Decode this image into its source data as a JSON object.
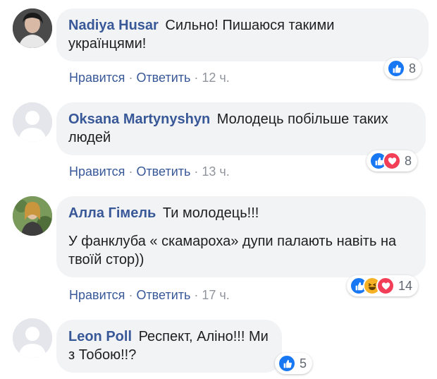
{
  "colors": {
    "link": "#385898",
    "like": "#1877f2",
    "love": "#f33e58",
    "haha": "#f7b125",
    "bubble": "#f2f3f5"
  },
  "comments": [
    {
      "author": "Nadiya Husar",
      "text": "Сильно! Пишаюся такими українцями!",
      "like": "Нравится",
      "reply": "Ответить",
      "time": "12 ч.",
      "reactions": [
        "like-icon"
      ],
      "reaction_count": "8",
      "avatar": "user-photo"
    },
    {
      "author": "Oksana Martynyshyn",
      "text": "Молодець побільше таких людей",
      "like": "Нравится",
      "reply": "Ответить",
      "time": "13 ч.",
      "reactions": [
        "like-icon",
        "love-icon"
      ],
      "reaction_count": "8",
      "avatar": "default-avatar"
    },
    {
      "author": "Алла Гімель",
      "text": "Ти молодець!!!",
      "text2": "У фанклуба « скамароха» дупи палають навіть на твоїй стор))",
      "like": "Нравится",
      "reply": "Ответить",
      "time": "17 ч.",
      "reactions": [
        "like-icon",
        "haha-icon",
        "love-icon"
      ],
      "reaction_count": "14",
      "avatar": "user-photo"
    },
    {
      "author": "Leon Poll",
      "text": "Респект, Аліно!!! Ми з Тобою!!?",
      "reactions": [
        "like-icon"
      ],
      "reaction_count": "5",
      "avatar": "default-avatar"
    }
  ]
}
